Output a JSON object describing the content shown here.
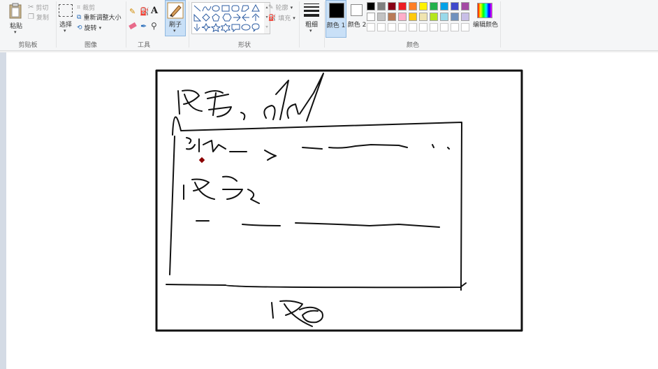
{
  "clipboard": {
    "paste_label": "粘贴",
    "cut_label": "剪切",
    "copy_label": "复制",
    "group_label": "剪贴板"
  },
  "image": {
    "select_label": "选择",
    "crop_label": "裁剪",
    "resize_label": "重新调整大小",
    "rotate_label": "旋转",
    "group_label": "图像"
  },
  "tools": {
    "group_label": "工具",
    "brushes_label": "刷子"
  },
  "shapes": {
    "outline_label": "轮廓",
    "fill_label": "填充",
    "group_label": "形状"
  },
  "size": {
    "label": "粗细"
  },
  "colors": {
    "color1_label": "颜色 1",
    "color2_label": "颜色 2",
    "edit_label": "编辑颜色",
    "group_label": "颜色",
    "color1_value": "#000000",
    "color2_value": "#ffffff",
    "palette_row1": [
      "#000000",
      "#7f7f7f",
      "#880015",
      "#ed1c24",
      "#ff7f27",
      "#fff200",
      "#22b14c",
      "#00a2e8",
      "#3f48cc",
      "#a349a4"
    ],
    "palette_row2": [
      "#ffffff",
      "#c3c3c3",
      "#b97a57",
      "#ffaec9",
      "#ffc90e",
      "#efe4b0",
      "#b5e61d",
      "#99d9ea",
      "#7092be",
      "#c8bfe7"
    ],
    "palette_row3": [
      "#ffffff",
      "#ffffff",
      "#ffffff",
      "#ffffff",
      "#ffffff",
      "#ffffff",
      "#ffffff",
      "#ffffff",
      "#ffffff",
      "#ffffff"
    ]
  }
}
